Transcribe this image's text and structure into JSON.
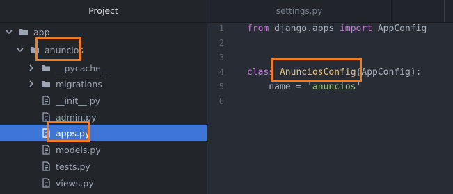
{
  "sidebar": {
    "title": "Project",
    "tree": [
      {
        "label": "app",
        "kind": "folder",
        "expanded": true
      },
      {
        "label": "anuncios",
        "kind": "folder",
        "expanded": true
      },
      {
        "label": "__pycache__",
        "kind": "folder",
        "expanded": false
      },
      {
        "label": "migrations",
        "kind": "folder",
        "expanded": false
      },
      {
        "label": "__init__.py",
        "kind": "file"
      },
      {
        "label": "admin.py",
        "kind": "file"
      },
      {
        "label": "apps.py",
        "kind": "file",
        "selected": true
      },
      {
        "label": "models.py",
        "kind": "file"
      },
      {
        "label": "tests.py",
        "kind": "file"
      },
      {
        "label": "views.py",
        "kind": "file"
      }
    ]
  },
  "editor": {
    "tab_title": "settings.py",
    "lines": [
      {
        "num": "1",
        "t1": "from",
        "t2": " django.apps ",
        "t3": "import",
        "t4": " AppConfig"
      },
      {
        "num": "2"
      },
      {
        "num": "3"
      },
      {
        "num": "4",
        "c1": "class",
        "c2": " ",
        "c3": "AnunciosConfig",
        "c4": "(AppConfig):"
      },
      {
        "num": "5",
        "s1": "    name = ",
        "s2": "'anuncios'"
      },
      {
        "num": "6"
      }
    ]
  },
  "colors": {
    "selection": "#3e76d8",
    "highlight_box": "#f47c20",
    "keyword": "#c678dd",
    "class_name": "#e5c07b",
    "string": "#98c379"
  }
}
